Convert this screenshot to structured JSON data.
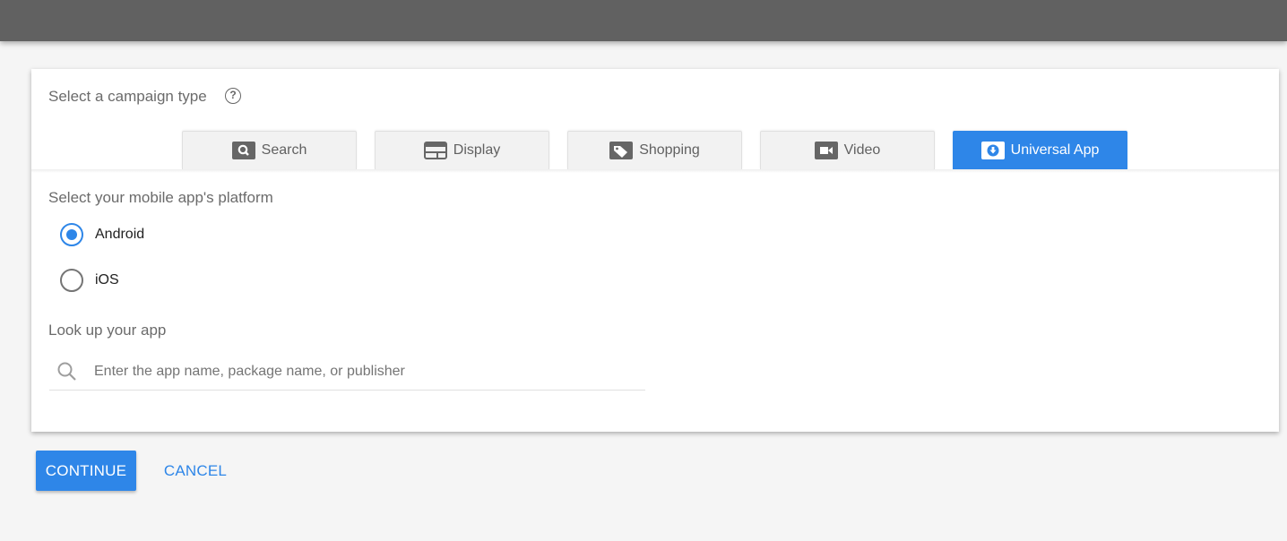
{
  "campaign_type": {
    "title": "Select a campaign type",
    "help_icon": "help-circle-icon",
    "tabs": [
      {
        "label": "Search",
        "icon": "search-icon",
        "active": false
      },
      {
        "label": "Display",
        "icon": "display-icon",
        "active": false
      },
      {
        "label": "Shopping",
        "icon": "tag-icon",
        "active": false
      },
      {
        "label": "Video",
        "icon": "video-camera-icon",
        "active": false
      },
      {
        "label": "Universal App",
        "icon": "app-download-icon",
        "active": true
      }
    ]
  },
  "platform": {
    "title": "Select your mobile app's platform",
    "options": [
      {
        "label": "Android",
        "checked": true
      },
      {
        "label": "iOS",
        "checked": false
      }
    ]
  },
  "app_lookup": {
    "title": "Look up your app",
    "value": "",
    "placeholder": "Enter the app name, package name, or publisher"
  },
  "actions": {
    "continue_label": "CONTINUE",
    "cancel_label": "CANCEL"
  },
  "colors": {
    "accent": "#2e86e8",
    "topbar": "#616161"
  }
}
